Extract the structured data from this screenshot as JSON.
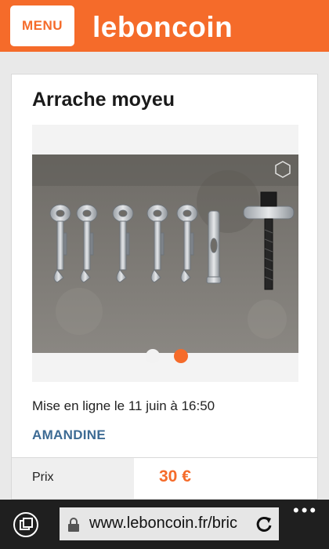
{
  "header": {
    "menu_label": "MENU",
    "logo_text": "leboncoin",
    "brand_color": "#f56b2a"
  },
  "ad": {
    "title": "Arrache moyeu",
    "posted": "Mise en ligne le 11 juin à 16:50",
    "seller": "AMANDINE",
    "price_label": "Prix",
    "price_value": "30 €",
    "gallery": {
      "image_count": 2,
      "active_index": 2
    }
  },
  "browser": {
    "url": "www.leboncoin.fr/bric",
    "tabs_icon": "tabs-icon",
    "lock_icon": "lock-icon",
    "refresh_icon": "refresh-icon",
    "more_icon": "more-icon"
  }
}
